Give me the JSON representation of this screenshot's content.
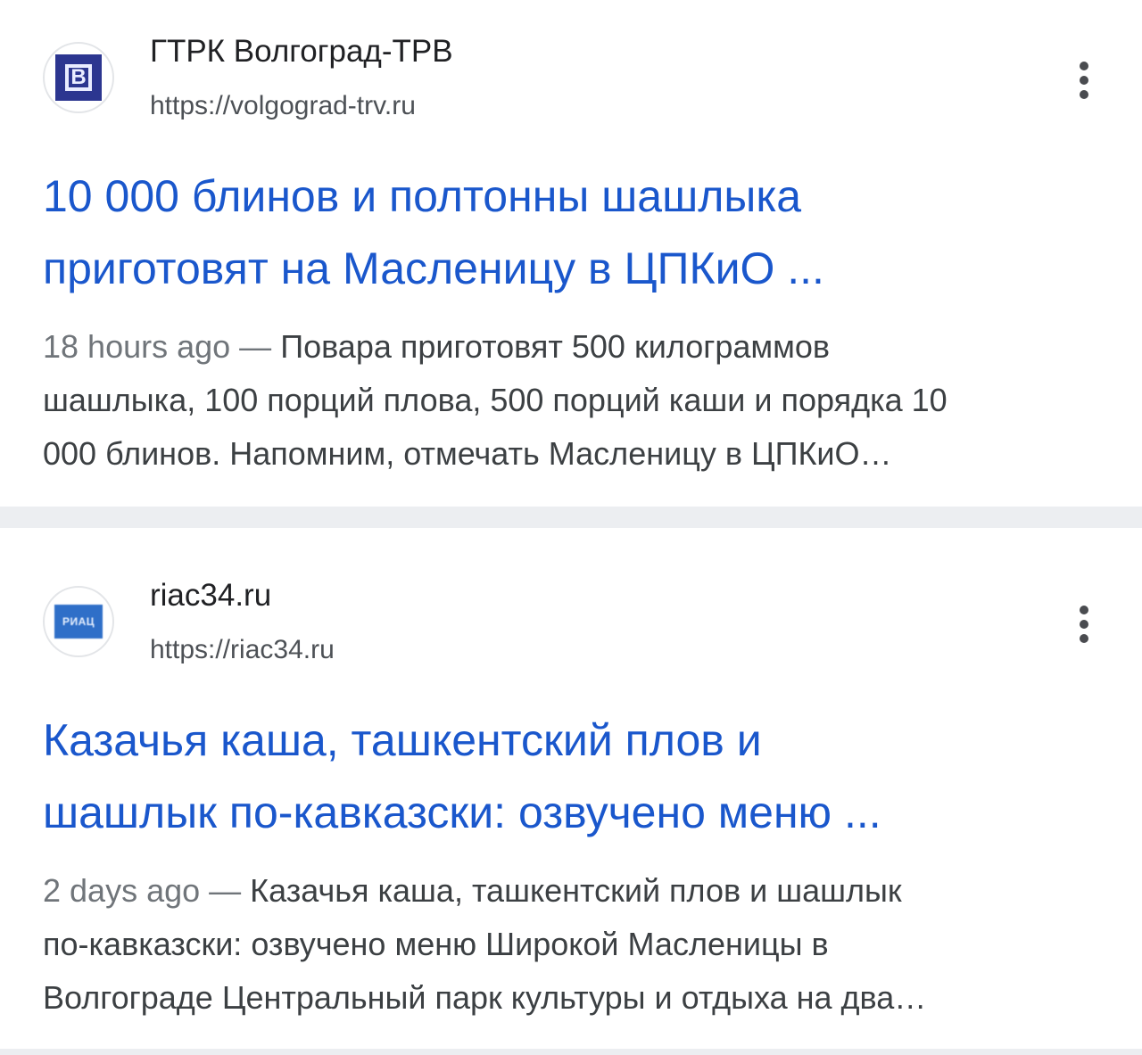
{
  "results": [
    {
      "site_name": "ГТРК Волгоград-ТРВ",
      "url": "https://volgograd-trv.ru",
      "favicon_text": "B",
      "title_line1": "10 000 блинов и полтонны шашлыка",
      "title_line2": "приготовят на Масленицу в ЦПКиО ...",
      "date": "18 hours ago",
      "separator": " — ",
      "snippet_line1": "Повара приготовят 500 килограммов",
      "snippet_line2": "шашлыка, 100 порций плова, 500 порций каши и порядка 10",
      "snippet_line3": "000 блинов. Напомним, отмечать Масленицу в ЦПКиО…"
    },
    {
      "site_name": "riac34.ru",
      "url": "https://riac34.ru",
      "favicon_text": "РИАЦ",
      "title_line1": "Казачья каша, ташкентский плов и",
      "title_line2": "шашлык по-кавказски: озвучено меню ...",
      "date": "2 days ago",
      "separator": " — ",
      "snippet_line1": "Казачья каша, ташкентский плов и шашлык",
      "snippet_line2": "по-кавказски: озвучено меню Широкой Масленицы в",
      "snippet_line3": "Волгограде Центральный парк культуры и отдыха на два…"
    }
  ],
  "icons": {
    "more_menu": "more-vert-icon"
  },
  "colors": {
    "title_link": "#1a57cc",
    "site_name": "#202124",
    "url": "#4d5156",
    "date": "#70757a",
    "snippet": "#3c4043",
    "divider": "#eceef1",
    "favicon_trv_bg": "#2c3690",
    "favicon_riac_bg": "#2f6fc8"
  }
}
